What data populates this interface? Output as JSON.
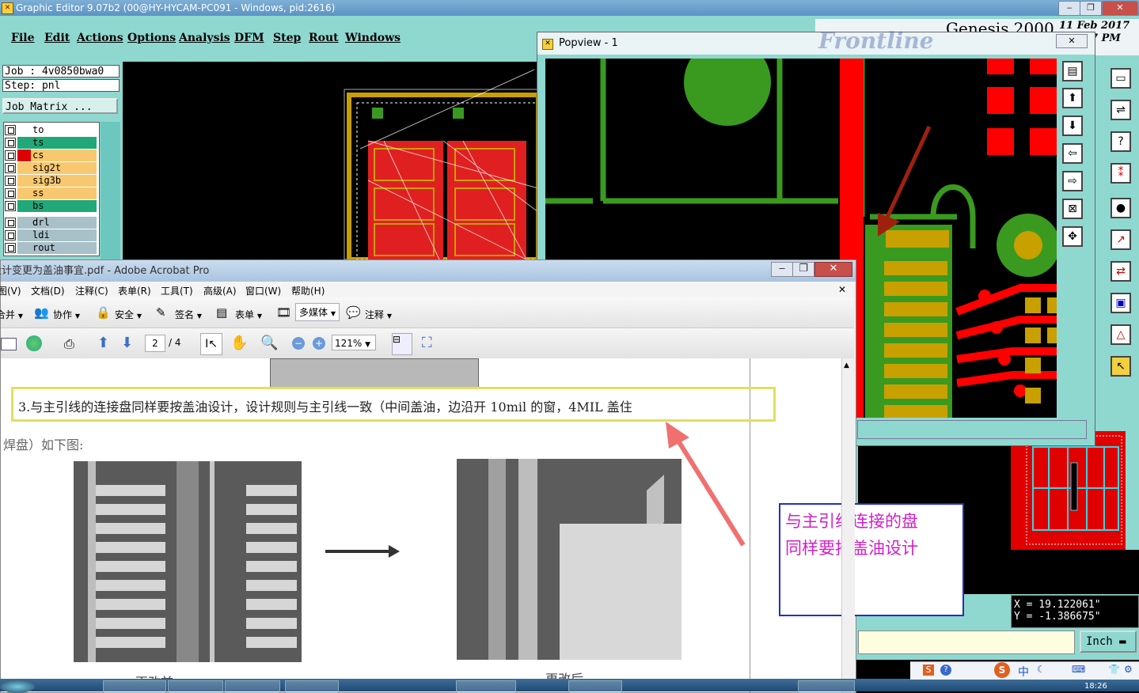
{
  "genesis": {
    "title": "Graphic Editor 9.07b2 (00@HY-HYCAM-PC091 - Windows, pid:2616)",
    "menu": [
      "File",
      "Edit",
      "Actions",
      "Options",
      "Analysis",
      "DFM",
      "Step",
      "Rout",
      "Windows"
    ],
    "job": "Job : 4v0850bwa0",
    "step": "Step: pnl",
    "job_matrix": "Job Matrix ...",
    "layers": [
      {
        "name": "to",
        "color": "#ffffff",
        "swatch": "#ffffff"
      },
      {
        "name": "ts",
        "color": "#20a878",
        "swatch": "#20a878"
      },
      {
        "name": "cs",
        "color": "#f8c870",
        "swatch": "#e00000"
      },
      {
        "name": "sig2t",
        "color": "#f8c870",
        "swatch": "#f8c870"
      },
      {
        "name": "sig3b",
        "color": "#f8c870",
        "swatch": "#f8c870"
      },
      {
        "name": "ss",
        "color": "#f8c870",
        "swatch": "#f8c870"
      },
      {
        "name": "bs",
        "color": "#20a878",
        "swatch": "#20a878"
      },
      {
        "name": "drl",
        "color": "#a8c0c8",
        "swatch": "#a8c0c8"
      },
      {
        "name": "ldi",
        "color": "#a8c0c8",
        "swatch": "#a8c0c8"
      },
      {
        "name": "rout",
        "color": "#a8c0c8",
        "swatch": "#a8c0c8"
      }
    ],
    "brand": "Genesis 2000",
    "date_line1": "11 Feb 2017",
    "date_line2": "7 PM",
    "logo_text": "Frontline",
    "coord_x": "X = 19.122061\"",
    "coord_y": "Y = -1.386675\"",
    "units": "Inch"
  },
  "popview": {
    "title": "Popview - 1"
  },
  "acrobat": {
    "title": "设计变更为盖油事宜.pdf - Adobe Acrobat Pro",
    "menu": [
      "图(V)",
      "文档(D)",
      "注释(C)",
      "表单(R)",
      "工具(T)",
      "高级(A)",
      "窗口(W)",
      "帮助(H)"
    ],
    "toolbar1": [
      "合并",
      "协作",
      "安全",
      "签名",
      "表单",
      "多媒体",
      "注释"
    ],
    "page_current": "2",
    "page_total": "/ 4",
    "zoom": "121%",
    "doc_line1": "3.与主引线的连接盘同样要按盖油设计，设计规则与主引线一致（中间盖油，边沿开 10mil 的窗，4MIL 盖住",
    "doc_line2": "焊盘）如下图:",
    "caption_before": "更改前",
    "caption_after": "更改后",
    "callout_line1": "与主引线连接的盘",
    "callout_line2": "同样要按盖油设计"
  },
  "taskbar": {
    "time": "18:26",
    "ime": "中"
  },
  "colors": {
    "genesis_bg": "#8fd8d0",
    "accent_red": "#ff0000",
    "pad_green": "#3a9a20",
    "pad_gold": "#c8a000",
    "callout": "#d020c8"
  }
}
